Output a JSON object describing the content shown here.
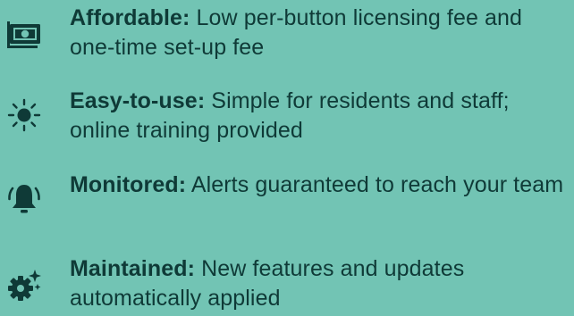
{
  "features": [
    {
      "icon": "money-icon",
      "title": "Affordable",
      "separator": ":",
      "description": "Low per-button licensing fee and one-time set-up fee"
    },
    {
      "icon": "sun-icon",
      "title": "Easy-to-use",
      "separator": ":",
      "description": "Simple for residents and staff; online training provided"
    },
    {
      "icon": "bell-icon",
      "title": "Monitored",
      "separator": ":",
      "description": "Alerts guaranteed to reach your team"
    },
    {
      "icon": "gear-sparkle-icon",
      "title": "Maintained",
      "separator": ":",
      "description": "New features and updates automatically applied"
    }
  ],
  "colors": {
    "background": "#72c4b4",
    "text": "#0f3a37"
  }
}
